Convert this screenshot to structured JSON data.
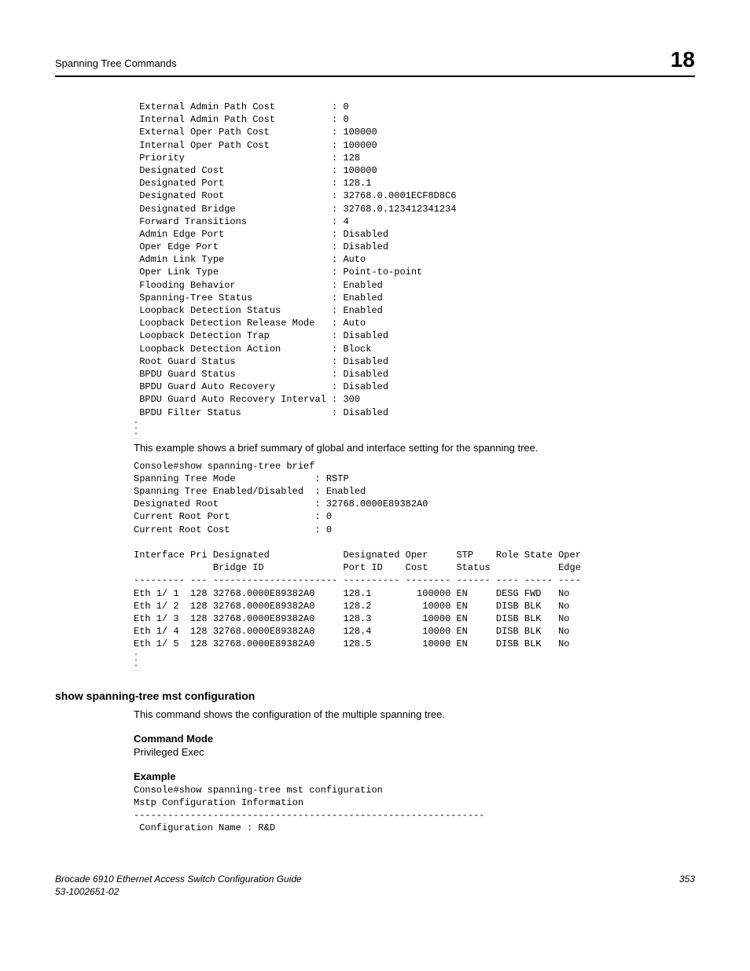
{
  "header": {
    "title": "Spanning Tree Commands",
    "chapter": "18"
  },
  "block1": " External Admin Path Cost          : 0\n Internal Admin Path Cost          : 0\n External Oper Path Cost           : 100000\n Internal Oper Path Cost           : 100000\n Priority                          : 128\n Designated Cost                   : 100000\n Designated Port                   : 128.1\n Designated Root                   : 32768.0.0001ECF8D8C6\n Designated Bridge                 : 32768.0.123412341234\n Forward Transitions               : 4\n Admin Edge Port                   : Disabled\n Oper Edge Port                    : Disabled\n Admin Link Type                   : Auto\n Oper Link Type                    : Point-to-point\n Flooding Behavior                 : Enabled\n Spanning-Tree Status              : Enabled\n Loopback Detection Status         : Enabled\n Loopback Detection Release Mode   : Auto\n Loopback Detection Trap           : Disabled\n Loopback Detection Action         : Block\n Root Guard Status                 : Disabled\n BPDU Guard Status                 : Disabled\n BPDU Guard Auto Recovery          : Disabled\n BPDU Guard Auto Recovery Interval : 300\n BPDU Filter Status                : Disabled",
  "example_intro": "This example shows a brief summary of global and interface setting for the spanning tree.",
  "block2": "Console#show spanning-tree brief\nSpanning Tree Mode              : RSTP\nSpanning Tree Enabled/Disabled  : Enabled\nDesignated Root                 : 32768.0000E89382A0\nCurrent Root Port               : 0\nCurrent Root Cost               : 0\n\nInterface Pri Designated             Designated Oper     STP    Role State Oper\n              Bridge ID              Port ID    Cost     Status            Edge\n--------- --- ---------------------- ---------- -------- ------ ---- ----- ----\nEth 1/ 1  128 32768.0000E89382A0     128.1        100000 EN     DESG FWD   No\nEth 1/ 2  128 32768.0000E89382A0     128.2         10000 EN     DISB BLK   No\nEth 1/ 3  128 32768.0000E89382A0     128.3         10000 EN     DISB BLK   No\nEth 1/ 4  128 32768.0000E89382A0     128.4         10000 EN     DISB BLK   No\nEth 1/ 5  128 32768.0000E89382A0     128.5         10000 EN     DISB BLK   No",
  "command": {
    "name": "show spanning-tree mst configuration",
    "description": "This command shows the configuration of the multiple spanning tree.",
    "mode_heading": "Command Mode",
    "mode_text": "Privileged Exec",
    "example_heading": "Example",
    "example_block": "Console#show spanning-tree mst configuration\nMstp Configuration Information\n--------------------------------------------------------------\n Configuration Name : R&D"
  },
  "footer": {
    "left_line1": "Brocade 6910 Ethernet Access Switch Configuration Guide",
    "left_line2": "53-1002651-02",
    "page": "353"
  }
}
